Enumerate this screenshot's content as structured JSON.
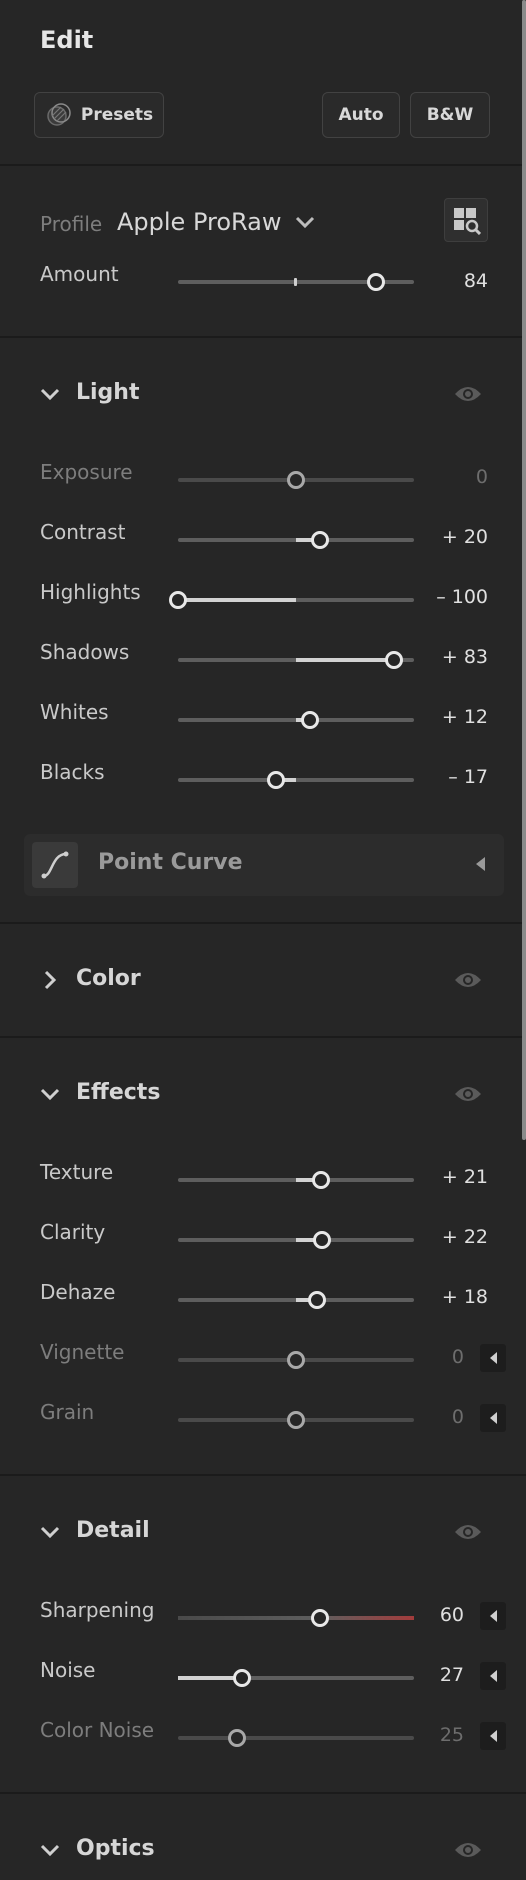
{
  "header": {
    "title": "Edit",
    "presets_label": "Presets",
    "auto_label": "Auto",
    "bw_label": "B&W"
  },
  "profile": {
    "label": "Profile",
    "value": "Apple ProRaw",
    "amount_label": "Amount",
    "amount_value": "84",
    "amount_level": 84
  },
  "light": {
    "title": "Light",
    "sliders": [
      {
        "label": "Exposure",
        "value": "0",
        "level": 0,
        "dim": true
      },
      {
        "label": "Contrast",
        "value": "+ 20",
        "level": 20
      },
      {
        "label": "Highlights",
        "value": "– 100",
        "level": -100
      },
      {
        "label": "Shadows",
        "value": "+ 83",
        "level": 83
      },
      {
        "label": "Whites",
        "value": "+ 12",
        "level": 12
      },
      {
        "label": "Blacks",
        "value": "– 17",
        "level": -17
      }
    ],
    "point_curve_label": "Point Curve"
  },
  "color": {
    "title": "Color"
  },
  "effects": {
    "title": "Effects",
    "sliders": [
      {
        "label": "Texture",
        "value": "+ 21",
        "level": 21
      },
      {
        "label": "Clarity",
        "value": "+ 22",
        "level": 22
      },
      {
        "label": "Dehaze",
        "value": "+ 18",
        "level": 18
      },
      {
        "label": "Vignette",
        "value": "0",
        "level": 0,
        "dim": true
      },
      {
        "label": "Grain",
        "value": "0",
        "level": 0,
        "dim": true
      }
    ]
  },
  "detail": {
    "title": "Detail",
    "sliders": [
      {
        "label": "Sharpening",
        "value": "60",
        "level": 60
      },
      {
        "label": "Noise",
        "value": "27",
        "level": 27
      },
      {
        "label": "Color Noise",
        "value": "25",
        "level": 25,
        "dim": true
      }
    ]
  },
  "optics": {
    "title": "Optics"
  },
  "colors": {
    "background": "#262626",
    "divider": "#1b1b1b",
    "text": "#d6d6d6",
    "dim_text": "#7d7d7d",
    "sharpening_accent": "#a33c3c"
  }
}
